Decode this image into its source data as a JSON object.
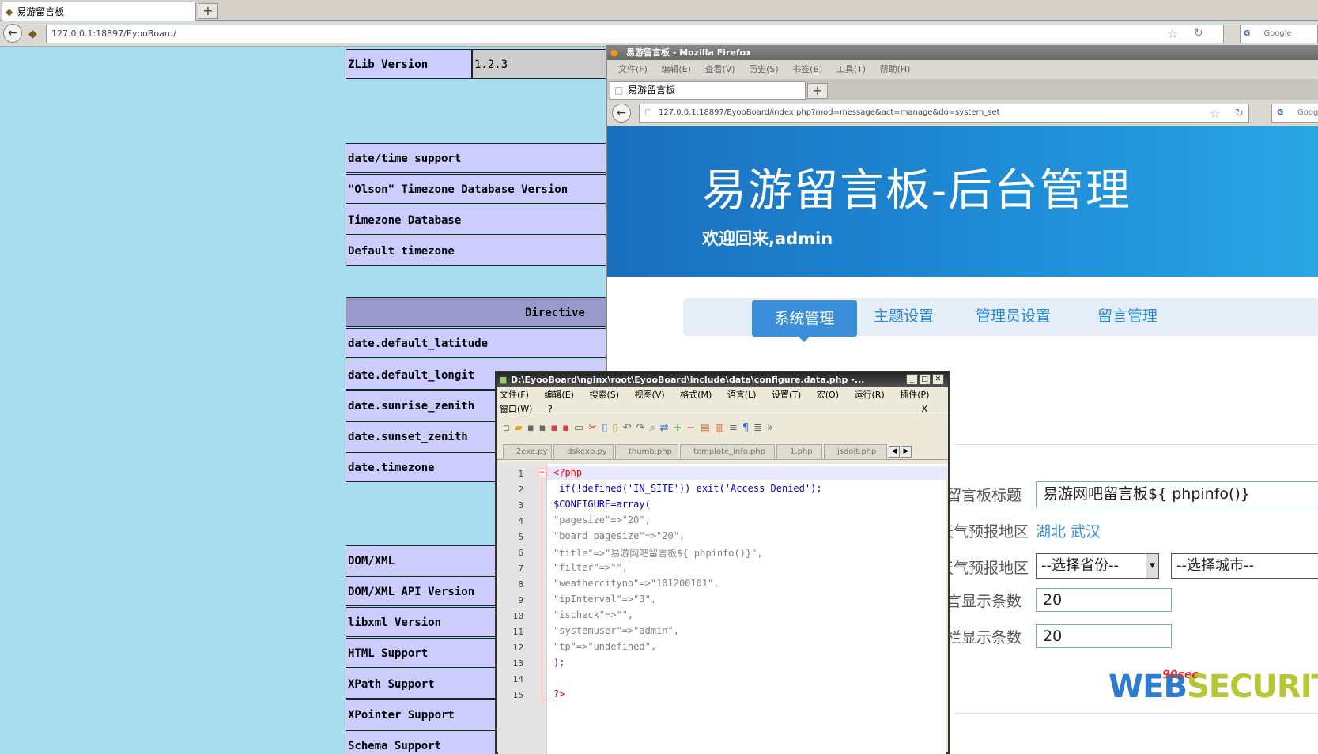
{
  "background_browser": {
    "tab_title": "易游留言板",
    "url": "127.0.0.1:18897/EyooBoard/",
    "search_placeholder": "Google",
    "new_tab_label": "+",
    "phpinfo_rows": [
      "ZLib Version",
      "date/time support",
      "\"Olson\" Timezone Database Version",
      "Timezone Database",
      "Default timezone",
      "Directive",
      "date.default_latitude",
      "date.default_longit",
      "date.sunrise_zenith",
      "date.sunset_zenith",
      "date.timezone",
      "DOM/XML",
      "DOM/XML API Version",
      "libxml Version",
      "HTML Support",
      "XPath Support",
      "XPointer Support",
      "Schema Support"
    ],
    "zlib_value": "1.2.3"
  },
  "front_browser": {
    "window_title": "易游留言板 - Mozilla Firefox",
    "menu": [
      "文件(F)",
      "编辑(E)",
      "查看(V)",
      "历史(S)",
      "书签(B)",
      "工具(T)",
      "帮助(H)"
    ],
    "tab_title": "易游留言板",
    "new_tab_label": "+",
    "url": "127.0.0.1:18897/EyooBoard/index.php?mod=message&act=manage&do=system_set",
    "search_placeholder": "Goog"
  },
  "site": {
    "title": "易游留言板-后台管理",
    "welcome": "欢迎回来,admin",
    "nav": [
      "系统管理",
      "主题设置",
      "管理员设置",
      "留言管理"
    ],
    "form": {
      "board_title_label": "留言板标题",
      "board_title_value": "易游网吧留言板${ phpinfo()}",
      "weather_current_label": "前天气预报地区",
      "weather_current_value": "湖北 武汉",
      "weather_change_label": "改天气预报地区",
      "province_select": "--选择省份--",
      "city_select": "--选择城市--",
      "page_size_label": "留言显示条数",
      "page_size_value": "20",
      "notice_size_label": "公告栏显示条数",
      "notice_size_value": "20"
    }
  },
  "editor": {
    "title": "D:\\EyooBoard\\nginx\\root\\EyooBoard\\include\\data\\configure.data.php -...",
    "menu_row1": [
      "文件(F)",
      "编辑(E)",
      "搜索(S)",
      "视图(V)",
      "格式(M)",
      "语言(L)",
      "设置(T)",
      "宏(O)",
      "运行(R)",
      "插件(P)"
    ],
    "menu_row2": [
      "窗口(W)",
      "?"
    ],
    "close_x": "X",
    "tabs": [
      "2exe.py",
      "dskexp.py",
      "thumb.php",
      "template_info.php",
      "1.php",
      "jsdoit.php"
    ],
    "lines": [
      "<?php",
      " if(!defined('IN_SITE')) exit('Access Denied');",
      "$CONFIGURE=array(",
      "\"pagesize\"=>\"20\",",
      "\"board_pagesize\"=>\"20\",",
      "\"title\"=>\"易游网吧留言板${ phpinfo()}\",",
      "\"filter\"=>\"\",",
      "\"weathercityno\"=>\"101200101\",",
      "\"ipInterval\"=>\"3\",",
      "\"ischeck\"=>\"\",",
      "\"systemuser\"=>\"admin\",",
      "\"tp\"=>\"undefined\",",
      ");",
      "",
      "?>"
    ]
  },
  "watermark": {
    "brand": "WEB SECURITY",
    "web": "WEB",
    "security": "SECURITY",
    "small": "90sec"
  }
}
